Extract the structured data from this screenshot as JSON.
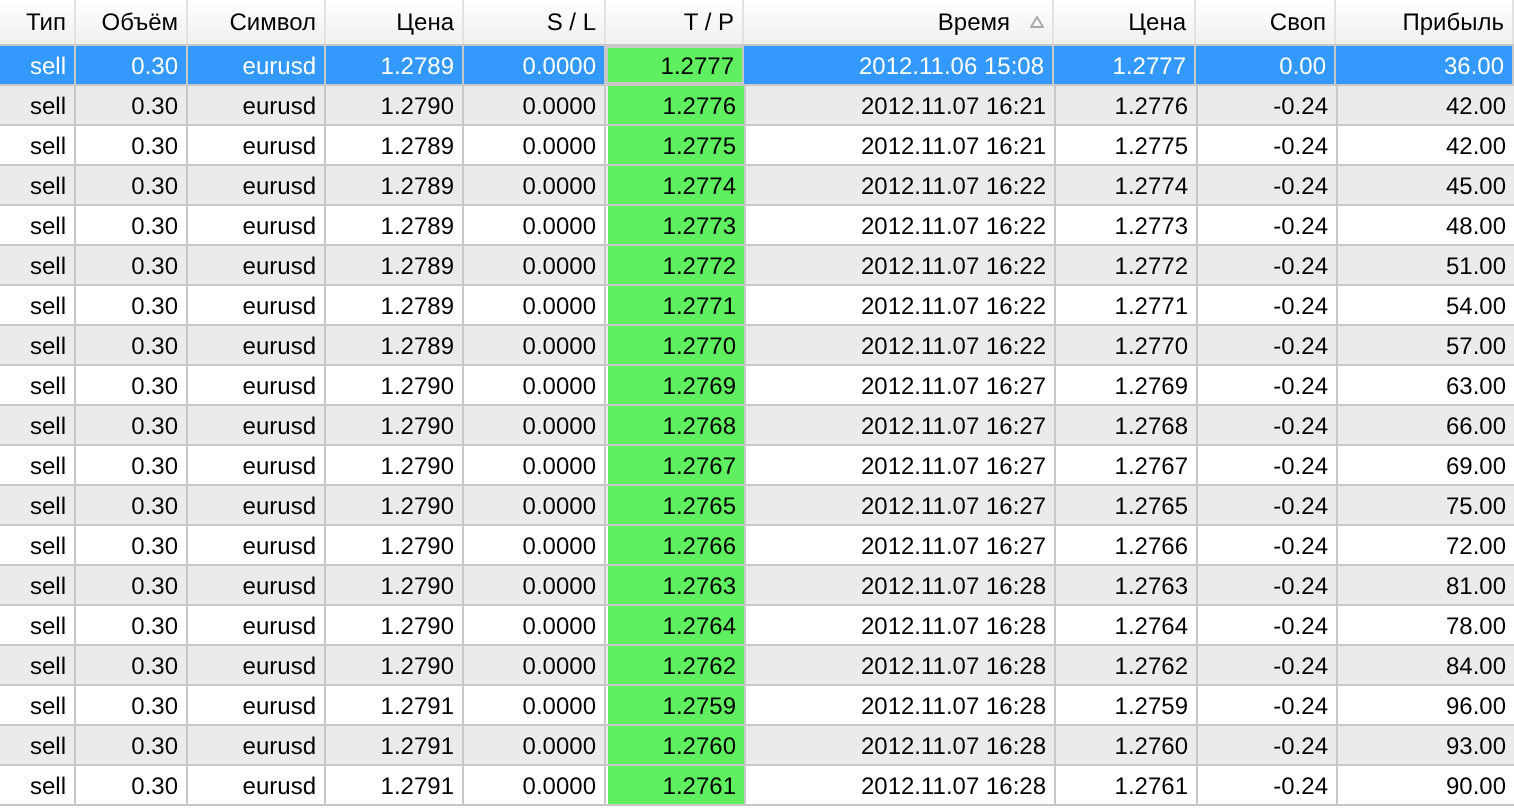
{
  "table": {
    "columns": [
      {
        "label": "Тип",
        "sorted": false,
        "highlight": false
      },
      {
        "label": "Объём",
        "sorted": false,
        "highlight": false
      },
      {
        "label": "Символ",
        "sorted": false,
        "highlight": false
      },
      {
        "label": "Цена",
        "sorted": false,
        "highlight": false
      },
      {
        "label": "S / L",
        "sorted": false,
        "highlight": false
      },
      {
        "label": "T / P",
        "sorted": false,
        "highlight": true
      },
      {
        "label": "Время",
        "sorted": true,
        "highlight": false
      },
      {
        "label": "Цена",
        "sorted": false,
        "highlight": false
      },
      {
        "label": "Своп",
        "sorted": false,
        "highlight": false
      },
      {
        "label": "Прибыль",
        "sorted": false,
        "highlight": false
      }
    ],
    "rows": [
      {
        "selected": true,
        "cells": [
          "sell",
          "0.30",
          "eurusd",
          "1.2789",
          "0.0000",
          "1.2777",
          "2012.11.06 15:08",
          "1.2777",
          "0.00",
          "36.00"
        ]
      },
      {
        "selected": false,
        "cells": [
          "sell",
          "0.30",
          "eurusd",
          "1.2790",
          "0.0000",
          "1.2776",
          "2012.11.07 16:21",
          "1.2776",
          "-0.24",
          "42.00"
        ]
      },
      {
        "selected": false,
        "cells": [
          "sell",
          "0.30",
          "eurusd",
          "1.2789",
          "0.0000",
          "1.2775",
          "2012.11.07 16:21",
          "1.2775",
          "-0.24",
          "42.00"
        ]
      },
      {
        "selected": false,
        "cells": [
          "sell",
          "0.30",
          "eurusd",
          "1.2789",
          "0.0000",
          "1.2774",
          "2012.11.07 16:22",
          "1.2774",
          "-0.24",
          "45.00"
        ]
      },
      {
        "selected": false,
        "cells": [
          "sell",
          "0.30",
          "eurusd",
          "1.2789",
          "0.0000",
          "1.2773",
          "2012.11.07 16:22",
          "1.2773",
          "-0.24",
          "48.00"
        ]
      },
      {
        "selected": false,
        "cells": [
          "sell",
          "0.30",
          "eurusd",
          "1.2789",
          "0.0000",
          "1.2772",
          "2012.11.07 16:22",
          "1.2772",
          "-0.24",
          "51.00"
        ]
      },
      {
        "selected": false,
        "cells": [
          "sell",
          "0.30",
          "eurusd",
          "1.2789",
          "0.0000",
          "1.2771",
          "2012.11.07 16:22",
          "1.2771",
          "-0.24",
          "54.00"
        ]
      },
      {
        "selected": false,
        "cells": [
          "sell",
          "0.30",
          "eurusd",
          "1.2789",
          "0.0000",
          "1.2770",
          "2012.11.07 16:22",
          "1.2770",
          "-0.24",
          "57.00"
        ]
      },
      {
        "selected": false,
        "cells": [
          "sell",
          "0.30",
          "eurusd",
          "1.2790",
          "0.0000",
          "1.2769",
          "2012.11.07 16:27",
          "1.2769",
          "-0.24",
          "63.00"
        ]
      },
      {
        "selected": false,
        "cells": [
          "sell",
          "0.30",
          "eurusd",
          "1.2790",
          "0.0000",
          "1.2768",
          "2012.11.07 16:27",
          "1.2768",
          "-0.24",
          "66.00"
        ]
      },
      {
        "selected": false,
        "cells": [
          "sell",
          "0.30",
          "eurusd",
          "1.2790",
          "0.0000",
          "1.2767",
          "2012.11.07 16:27",
          "1.2767",
          "-0.24",
          "69.00"
        ]
      },
      {
        "selected": false,
        "cells": [
          "sell",
          "0.30",
          "eurusd",
          "1.2790",
          "0.0000",
          "1.2765",
          "2012.11.07 16:27",
          "1.2765",
          "-0.24",
          "75.00"
        ]
      },
      {
        "selected": false,
        "cells": [
          "sell",
          "0.30",
          "eurusd",
          "1.2790",
          "0.0000",
          "1.2766",
          "2012.11.07 16:27",
          "1.2766",
          "-0.24",
          "72.00"
        ]
      },
      {
        "selected": false,
        "cells": [
          "sell",
          "0.30",
          "eurusd",
          "1.2790",
          "0.0000",
          "1.2763",
          "2012.11.07 16:28",
          "1.2763",
          "-0.24",
          "81.00"
        ]
      },
      {
        "selected": false,
        "cells": [
          "sell",
          "0.30",
          "eurusd",
          "1.2790",
          "0.0000",
          "1.2764",
          "2012.11.07 16:28",
          "1.2764",
          "-0.24",
          "78.00"
        ]
      },
      {
        "selected": false,
        "cells": [
          "sell",
          "0.30",
          "eurusd",
          "1.2790",
          "0.0000",
          "1.2762",
          "2012.11.07 16:28",
          "1.2762",
          "-0.24",
          "84.00"
        ]
      },
      {
        "selected": false,
        "cells": [
          "sell",
          "0.30",
          "eurusd",
          "1.2791",
          "0.0000",
          "1.2759",
          "2012.11.07 16:28",
          "1.2759",
          "-0.24",
          "96.00"
        ]
      },
      {
        "selected": false,
        "cells": [
          "sell",
          "0.30",
          "eurusd",
          "1.2791",
          "0.0000",
          "1.2760",
          "2012.11.07 16:28",
          "1.2760",
          "-0.24",
          "93.00"
        ]
      },
      {
        "selected": false,
        "cells": [
          "sell",
          "0.30",
          "eurusd",
          "1.2791",
          "0.0000",
          "1.2761",
          "2012.11.07 16:28",
          "1.2761",
          "-0.24",
          "90.00"
        ]
      }
    ]
  }
}
